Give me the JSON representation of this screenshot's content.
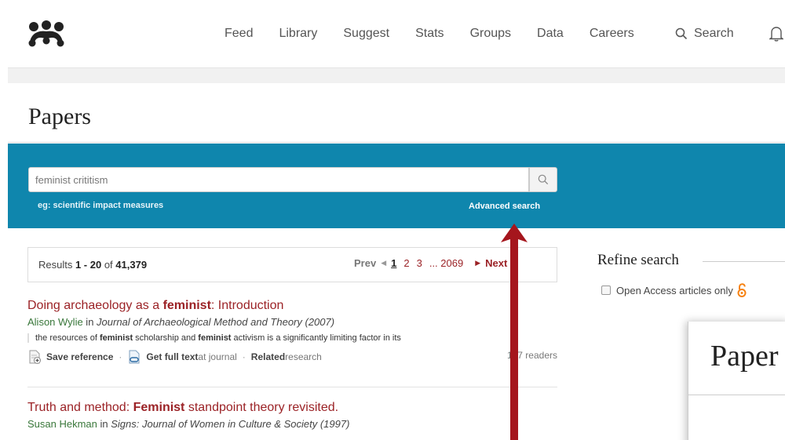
{
  "nav": {
    "items": [
      "Feed",
      "Library",
      "Suggest",
      "Stats",
      "Groups",
      "Data",
      "Careers"
    ],
    "search_label": "Search"
  },
  "page": {
    "title": "Papers"
  },
  "search": {
    "value": "feminist crititism",
    "hint": "eg: scientific impact measures",
    "advanced": "Advanced search"
  },
  "results": {
    "prefix": "Results ",
    "range": "1 - 20",
    "of": " of ",
    "total": "41,379",
    "pager": {
      "prev": "Prev",
      "pages": [
        "1",
        "2",
        "3"
      ],
      "ellipsis": "... 2069",
      "next": "Next"
    }
  },
  "items": [
    {
      "title_pre": "Doing archaeology as a ",
      "title_bold": "feminist",
      "title_post": ": Introduction",
      "author": "Alison Wylie",
      "in": " in ",
      "journal": "Journal of Archaeological Method and Theory (2007)",
      "snippet_1": "the resources of ",
      "snippet_b1": "feminist",
      "snippet_2": " scholarship and ",
      "snippet_b2": "feminist",
      "snippet_3": " activism is a significantly limiting factor in its",
      "save": "Save reference",
      "fulltext": "Get full text",
      "fulltext_src": " at journal",
      "related": "Related",
      "related_suffix": " research",
      "readers": "107 readers"
    },
    {
      "title_pre": "Truth and method: ",
      "title_bold": "Feminist",
      "title_post": " standpoint theory revisited.",
      "author": "Susan Hekman",
      "in": " in ",
      "journal": "Signs: Journal of Women in Culture & Society (1997)"
    }
  ],
  "sidebar": {
    "refine": "Refine search",
    "open_access": "Open Access articles only"
  },
  "overlay": {
    "title": "Paper"
  },
  "colors": {
    "accent": "#9b2226",
    "band": "#0f86ad",
    "arrow": "#a5161d"
  }
}
